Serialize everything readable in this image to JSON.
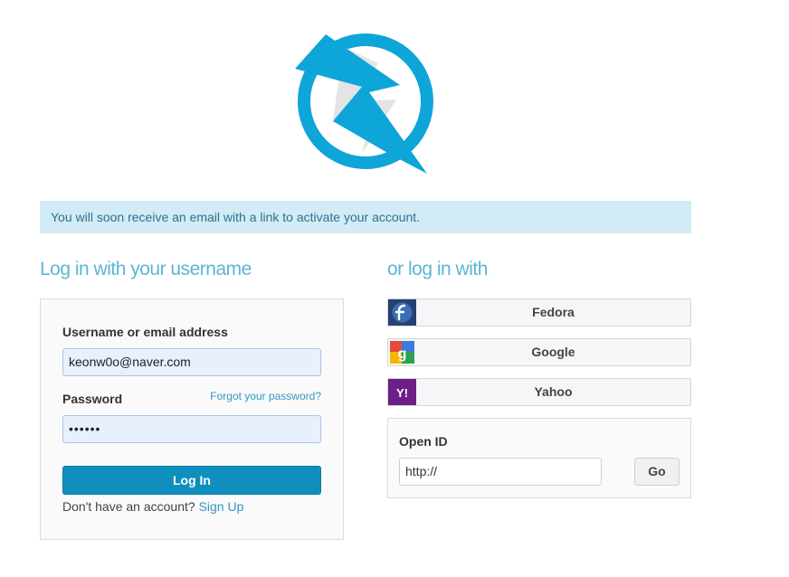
{
  "alert": {
    "message": "You will soon receive an email with a link to activate your account."
  },
  "login": {
    "heading": "Log in with your username",
    "username_label": "Username or email address",
    "username_value": "keonw0o@naver.com",
    "password_label": "Password",
    "password_value": "••••••",
    "forgot_link": "Forgot your password?",
    "login_button": "Log In",
    "signup_prompt": "Don't have an account?",
    "signup_link": "Sign Up"
  },
  "social": {
    "heading": "or log in with",
    "providers": [
      {
        "name": "Fedora",
        "icon": "fedora-icon"
      },
      {
        "name": "Google",
        "icon": "google-icon"
      },
      {
        "name": "Yahoo",
        "icon": "yahoo-icon"
      }
    ],
    "openid": {
      "label": "Open ID",
      "value": "http://",
      "go_button": "Go"
    }
  },
  "colors": {
    "brand": "#0ea5d8",
    "heading": "#5bb6d4",
    "alert_bg": "#d1ecf4",
    "login_button": "#0e8fbe"
  }
}
